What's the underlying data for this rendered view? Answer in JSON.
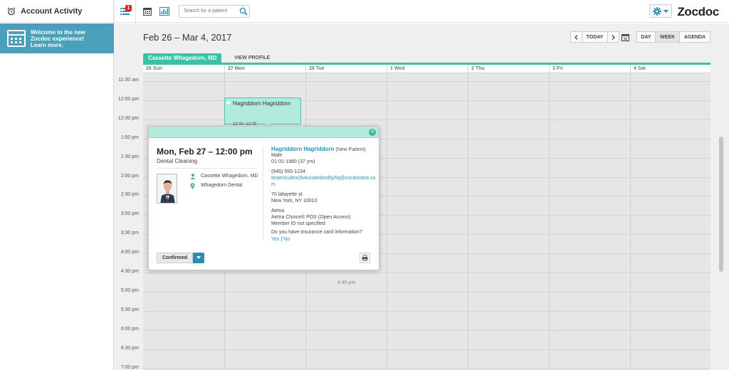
{
  "sidebar": {
    "title": "Account Activity",
    "banner_line1": "Welcome to the new Zocdoc experience!",
    "banner_line2": "Learn more."
  },
  "topbar": {
    "badge_count": "1",
    "search_placeholder": "Search for a patient",
    "logo": "Zocdoc"
  },
  "calendar": {
    "date_range": "Feb 26 – Mar 4, 2017",
    "today_label": "TODAY",
    "view_day": "DAY",
    "view_week": "WEEK",
    "view_agenda": "AGENDA",
    "provider_name": "Cassette Whagedorn, MD",
    "view_profile": "VIEW PROFILE",
    "days": [
      "26 Sun",
      "27 Mon",
      "28 Tue",
      "1 Wed",
      "2 Thu",
      "3 Fri",
      "4 Sat"
    ],
    "times": [
      "11:30 am",
      "12:00 pm",
      "12:30 pm",
      "1:00 pm",
      "1:30 pm",
      "2:00 pm",
      "2:30 pm",
      "3:00 pm",
      "3:30 pm",
      "4:00 pm",
      "4:30 pm",
      "5:00 pm",
      "5:30 pm",
      "6:00 pm",
      "6:30 pm",
      "7:00 pm"
    ],
    "time_marker": "4:45 pm"
  },
  "appointment": {
    "name": "Hagriddorn Hagriddorn",
    "time_short": "12:40–12:45"
  },
  "popup": {
    "date": "Mon, Feb 27 – 12:00 pm",
    "type": "Dental Cleaning",
    "doctor": "Cassette Whagedorn, MD",
    "location": "Whagedorn Dental",
    "status": "Confirmed",
    "patient_name": "Hagriddorn Hagriddorn",
    "new_patient": "(New Patient)",
    "gender": "Male",
    "dob": "01-01-1980 (37 yrs)",
    "phone": "(646) 555-1234",
    "email_line1": "testertcu8rw2b4ucalmkind6y5q@zocdoctest.co",
    "email_line2": "m",
    "address1": "70 lafayette st",
    "address2": "New York, NY 10010",
    "insurance1": "Aetna",
    "insurance2": "Aetna Choice® POS (Open Access)",
    "insurance3": "Member ID not specified",
    "card_question": "Do you have insurance card information?",
    "yes": "Yes",
    "sep": "|",
    "no": "No"
  },
  "colors": {
    "accent": "#3bc1a8",
    "appointment_fill": "#b2eadb",
    "link": "#2a8db3",
    "banner": "#4aa0bb",
    "badge": "#e02020"
  }
}
